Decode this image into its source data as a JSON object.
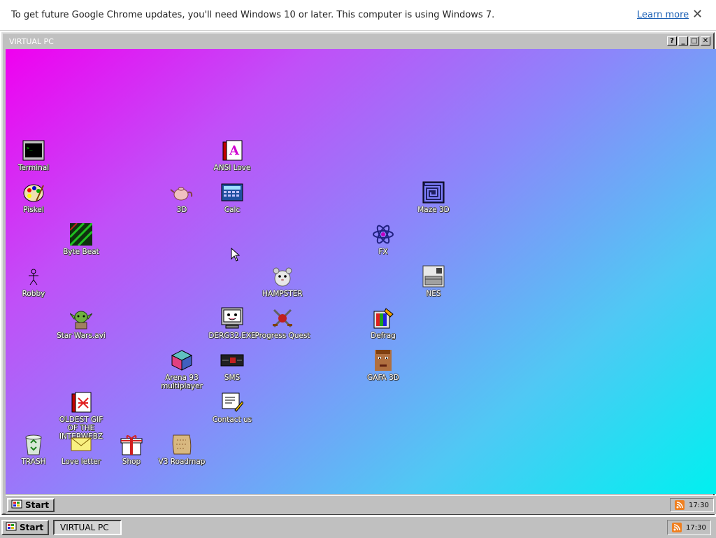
{
  "infobar": {
    "message": "To get future Google Chrome updates, you'll need Windows 10 or later. This computer is using Windows 7.",
    "learn_more": "Learn more",
    "close": "✕"
  },
  "window": {
    "title": "VIRTUAL PC",
    "buttons": [
      "?",
      "_",
      "□",
      "✕"
    ]
  },
  "desktop": {
    "icons": [
      {
        "label": "Terminal",
        "icon": "terminal-icon"
      },
      {
        "label": "ANSI Love",
        "icon": "ansi-love-icon"
      },
      {
        "label": "Piskel",
        "icon": "paint-palette-icon"
      },
      {
        "label": "3D",
        "icon": "teapot-icon"
      },
      {
        "label": "Calc",
        "icon": "calculator-icon"
      },
      {
        "label": "Maze 3D",
        "icon": "maze-icon"
      },
      {
        "label": "Byte Beat",
        "icon": "byte-beat-icon"
      },
      {
        "label": "FX",
        "icon": "atom-icon"
      },
      {
        "label": "Robby",
        "icon": "stick-figure-icon"
      },
      {
        "label": "HAMPSTER",
        "icon": "hamster-icon"
      },
      {
        "label": "NES",
        "icon": "nes-console-icon"
      },
      {
        "label": "Star Wars.avi",
        "icon": "yoda-icon"
      },
      {
        "label": "DERG32.EXE",
        "icon": "computer-face-icon"
      },
      {
        "label": "Progress Quest",
        "icon": "crossed-swords-icon"
      },
      {
        "label": "Defrag",
        "icon": "defrag-icon"
      },
      {
        "label": "Arena 93 multiplayer",
        "icon": "cube-icon"
      },
      {
        "label": "SMS",
        "icon": "sega-console-icon"
      },
      {
        "label": "GAFA 3D",
        "icon": "doom-face-icon"
      },
      {
        "label": "Contact us",
        "icon": "contact-note-icon"
      },
      {
        "label": "OLDEST GIF OF THE INTERWEBZ",
        "icon": "gif-file-icon"
      },
      {
        "label": "TRASH",
        "icon": "recycle-bin-icon"
      },
      {
        "label": "Love letter",
        "icon": "envelope-icon"
      },
      {
        "label": "Shop",
        "icon": "gift-icon"
      },
      {
        "label": "V3 Roadmap",
        "icon": "map-scroll-icon"
      }
    ]
  },
  "inner_taskbar": {
    "start_label": "Start",
    "clock": "17:30"
  },
  "outer_taskbar": {
    "start_label": "Start",
    "task_label": "VIRTUAL PC",
    "clock": "17:30"
  }
}
